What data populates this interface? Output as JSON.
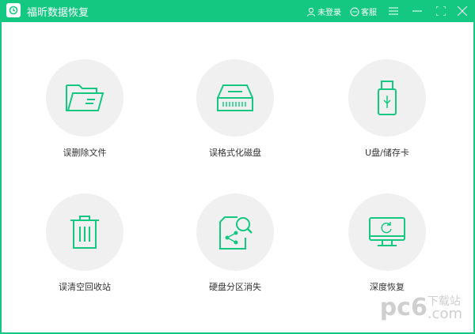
{
  "app": {
    "title": "福昕数据恢复",
    "accent": "#14c882"
  },
  "header": {
    "login": "未登录",
    "service": "客服"
  },
  "cards": [
    {
      "label": "误删除文件",
      "icon": "folder-icon"
    },
    {
      "label": "误格式化磁盘",
      "icon": "disk-icon"
    },
    {
      "label": "U盘/储存卡",
      "icon": "usb-icon"
    },
    {
      "label": "误清空回收站",
      "icon": "trash-icon"
    },
    {
      "label": "硬盘分区消失",
      "icon": "partition-icon"
    },
    {
      "label": "深度恢复",
      "icon": "monitor-icon"
    }
  ],
  "watermark": {
    "brand": "pc6",
    "tag": "下载站",
    "domain": ".com"
  }
}
